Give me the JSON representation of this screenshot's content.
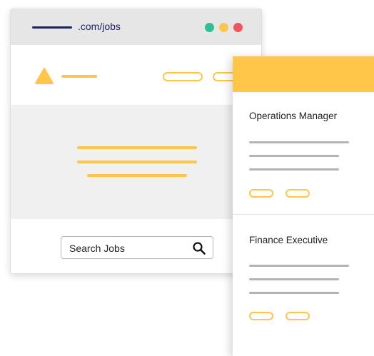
{
  "browser": {
    "url_text": ".com/jobs",
    "window_controls": [
      {
        "name": "green",
        "color": "#2bc295"
      },
      {
        "name": "yellow",
        "color": "#ffc64a"
      },
      {
        "name": "red",
        "color": "#f2545b"
      }
    ]
  },
  "search": {
    "label": "Search Jobs",
    "icon": "search-icon"
  },
  "jobs": [
    {
      "title": "Operations Manager"
    },
    {
      "title": "Finance Executive"
    }
  ],
  "colors": {
    "accent": "#ffc64a",
    "url_underline": "#1b1f5f",
    "hero_background": "#f0f0f0",
    "placeholder_line": "#b3b3b3"
  }
}
